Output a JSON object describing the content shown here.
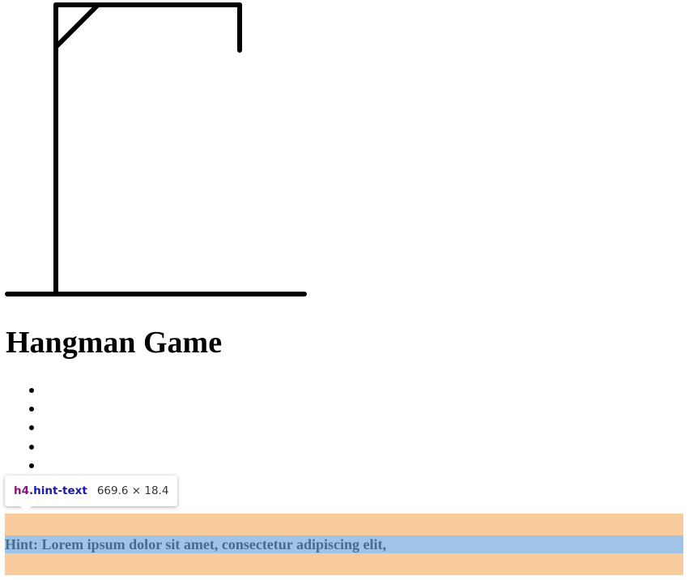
{
  "game": {
    "title": "Hangman Game",
    "word_slots": [
      "",
      "",
      "",
      "",
      ""
    ],
    "hint": "Hint: Lorem ipsum dolor sit amet, consectetur adipiscing elit,"
  },
  "devtools_tooltip": {
    "tag": "h4",
    "class_name": ".hint-text",
    "size": "669.6 × 18.4"
  },
  "colors": {
    "margin_highlight": "#f8cb9c",
    "content_highlight": "#a0c4e7",
    "hint_text": "#4a6a8c"
  }
}
